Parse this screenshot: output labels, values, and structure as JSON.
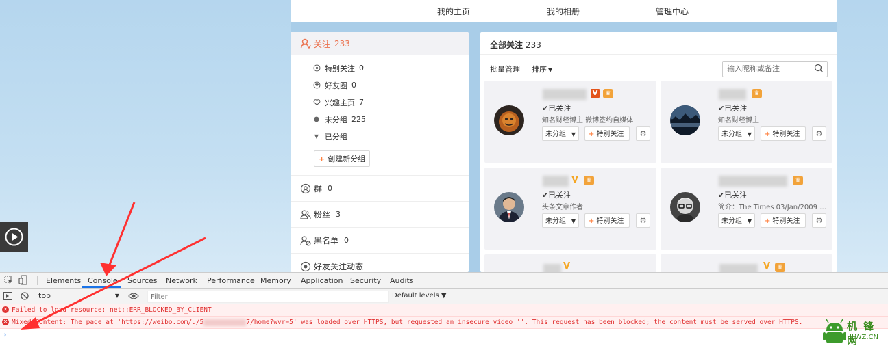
{
  "topnav": {
    "items": [
      "我的主页",
      "我的相册",
      "管理中心"
    ]
  },
  "sidebar": {
    "follow_label": "关注",
    "follow_count": "233",
    "sub_items": [
      {
        "label": "特别关注",
        "count": "0"
      },
      {
        "label": "好友圈",
        "count": "0"
      },
      {
        "label": "兴趣主页",
        "count": "7"
      },
      {
        "label": "未分组",
        "count": "225"
      },
      {
        "label": "已分组",
        "count": ""
      }
    ],
    "create_group": "创建新分组",
    "rows": [
      {
        "label": "群",
        "count": "0"
      },
      {
        "label": "粉丝",
        "count": "3"
      },
      {
        "label": "黑名单",
        "count": "0"
      },
      {
        "label": "好友关注动态",
        "count": ""
      }
    ]
  },
  "main": {
    "title": "全部关注",
    "title_count": "233",
    "batch_label": "批量管理",
    "sort_label": "排序",
    "search_placeholder": "输入昵称或备注",
    "cards": [
      {
        "followed": "已关注",
        "desc": "知名财经博主 微博签约自媒体",
        "group": "未分组",
        "special": "特别关注"
      },
      {
        "followed": "已关注",
        "desc": "知名财经博主",
        "group": "未分组",
        "special": "特别关注"
      },
      {
        "followed": "已关注",
        "desc": "头条文章作者",
        "group": "未分组",
        "special": "特别关注"
      },
      {
        "followed": "已关注",
        "desc": "简介：The Times 03/Jan/2009 C...",
        "group": "未分组",
        "special": "特别关注"
      }
    ]
  },
  "devtools": {
    "tabs": [
      "Elements",
      "Console",
      "Sources",
      "Network",
      "Performance",
      "Memory",
      "Application",
      "Security",
      "Audits"
    ],
    "active_tab": "Console",
    "context": "top",
    "filter_placeholder": "Filter",
    "levels": "Default levels ▼",
    "messages": {
      "m1": "Failed to load resource: net::ERR_BLOCKED_BY_CLIENT",
      "m2_prefix": "Mixed Content: The page at '",
      "m2_link_a": "https://weibo.com/u/5",
      "m2_link_b": "7/home?wvr=5",
      "m2_suffix": "' was loaded over HTTPS, but requested an insecure video ''. This request has been blocked; the content must be served over HTTPS."
    },
    "prompt": "›"
  },
  "watermark": {
    "line1": "机 锋 网",
    "line2": "JLWZ.CN"
  },
  "colors": {
    "accent_orange": "#eb7350",
    "error_red": "#e03030",
    "devtools_blue": "#1a73e8"
  }
}
